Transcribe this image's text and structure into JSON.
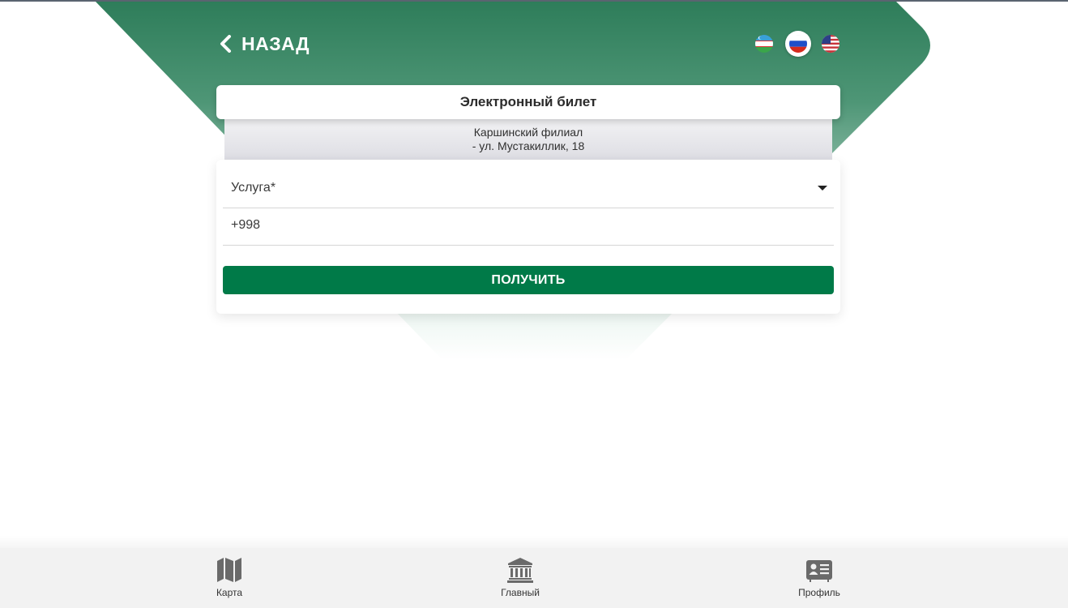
{
  "header": {
    "back_label": "НАЗАД",
    "languages": [
      {
        "code": "uz",
        "icon": "uzbekistan-flag-icon",
        "active": false
      },
      {
        "code": "ru",
        "icon": "russia-flag-icon",
        "active": true
      },
      {
        "code": "en",
        "icon": "usa-flag-icon",
        "active": false
      }
    ]
  },
  "ticket": {
    "title": "Электронный билет",
    "branch_name": "Каршинский филиал",
    "branch_address": "- ул. Мустакиллик, 18"
  },
  "form": {
    "service_placeholder": "Услуга*",
    "phone_value": "+998",
    "submit_label": "ПОЛУЧИТЬ"
  },
  "bottom_nav": {
    "items": [
      {
        "label": "Карта",
        "icon": "map-icon"
      },
      {
        "label": "Главный",
        "icon": "bank-building-icon"
      },
      {
        "label": "Профиль",
        "icon": "id-card-icon"
      }
    ]
  },
  "colors": {
    "brand_green_dark": "#2e7d5a",
    "brand_green_light": "#7fb39c",
    "button_green": "#007a48",
    "nav_background": "#f2f2f2"
  }
}
